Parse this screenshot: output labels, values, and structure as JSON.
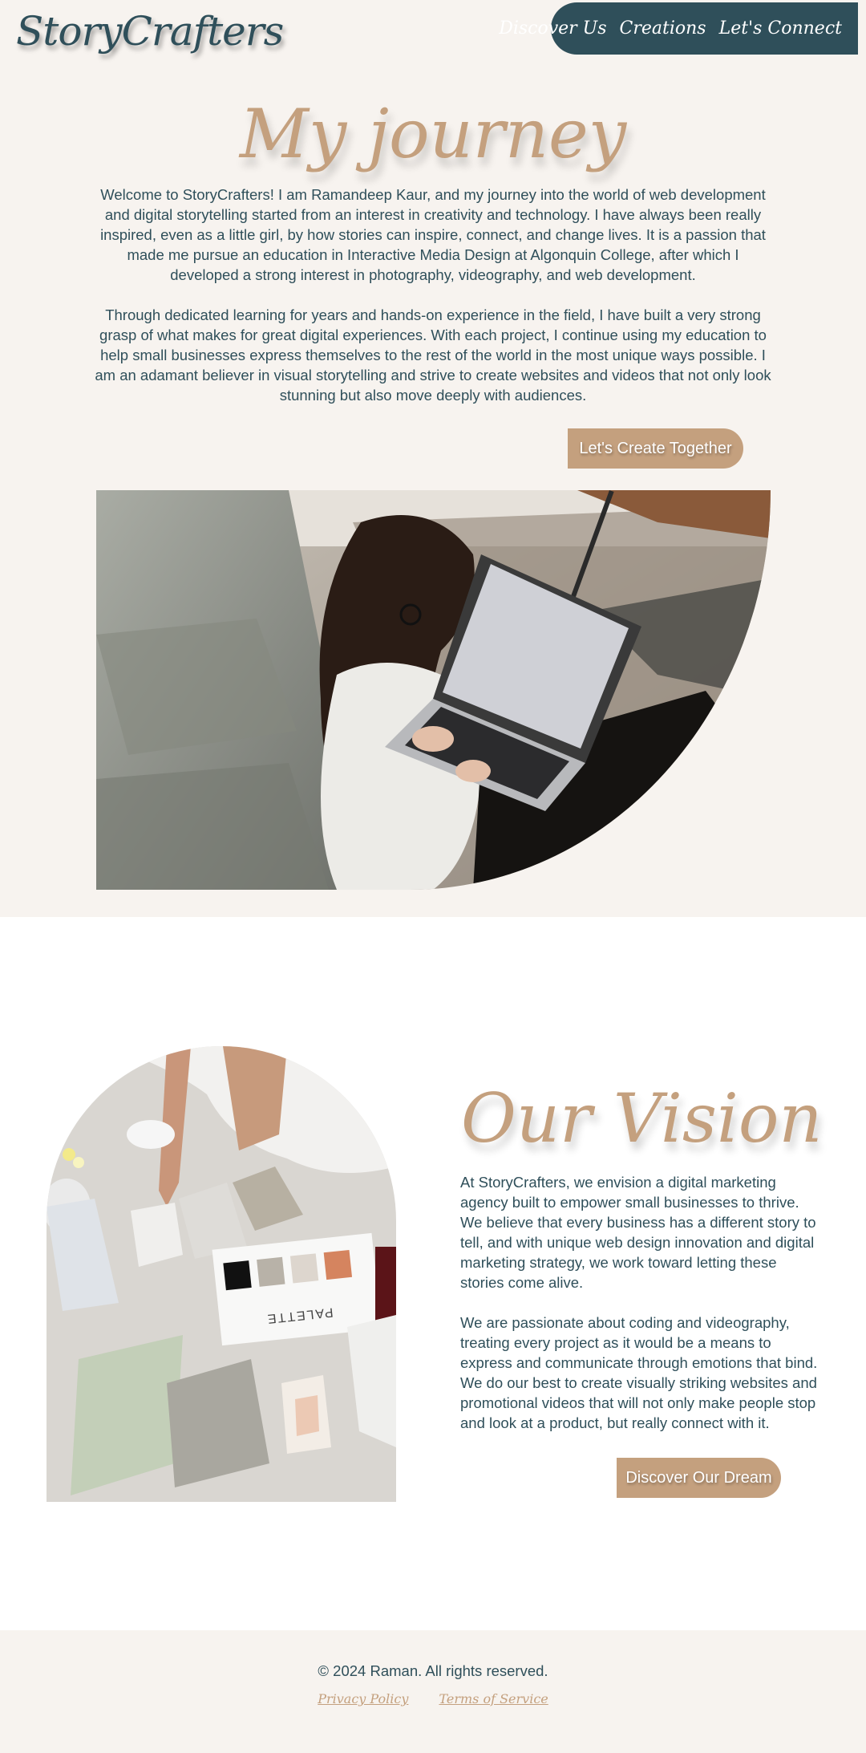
{
  "header": {
    "logo": "StoryCrafters",
    "nav": [
      "Discover Us",
      "Creations",
      "Let's Connect"
    ]
  },
  "journey": {
    "title": "My journey",
    "paragraphs": [
      "Welcome to StoryCrafters! I am Ramandeep Kaur, and my journey into the world of web development and digital storytelling started from an interest in creativity and technology. I have always been really inspired, even as a little girl, by how stories can inspire, connect, and change lives. It is a passion that made me pursue an education in Interactive Media Design at Algonquin College, after which I developed a strong interest in photography, videography, and web development.",
      "Through dedicated learning for years and hands-on experience in the field, I have built a very strong grasp of what makes for great digital experiences. With each project, I continue using my education to help small businesses express themselves to the rest of the world in the most unique ways possible. I am an adamant believer in visual storytelling and strive to create websites and videos that not only look stunning but also move deeply with audiences."
    ],
    "button": "Let's Create Together"
  },
  "vision": {
    "title": "Our Vision",
    "paragraphs": [
      "At StoryCrafters, we envision a digital marketing agency built to empower small businesses to thrive. We believe that every business has a different story to tell, and with unique web design innovation and digital marketing strategy, we work toward letting these stories come alive.",
      "We are passionate about coding and videography, treating every project as it would be a means to express and communicate through emotions that bind. We do our best to create visually striking websites and promotional videos that will not only make people stop and look at a product, but really connect with it."
    ],
    "button": "Discover Our Dream",
    "palette_card_text": "PALETTE"
  },
  "footer": {
    "copyright": "© 2024 Raman. All rights reserved.",
    "links": [
      "Privacy Policy",
      "Terms of Service"
    ]
  },
  "colors": {
    "primary": "#2f4f5a",
    "accent": "#c4a07e",
    "section_bg": "#f7f3ef",
    "white": "#ffffff"
  }
}
